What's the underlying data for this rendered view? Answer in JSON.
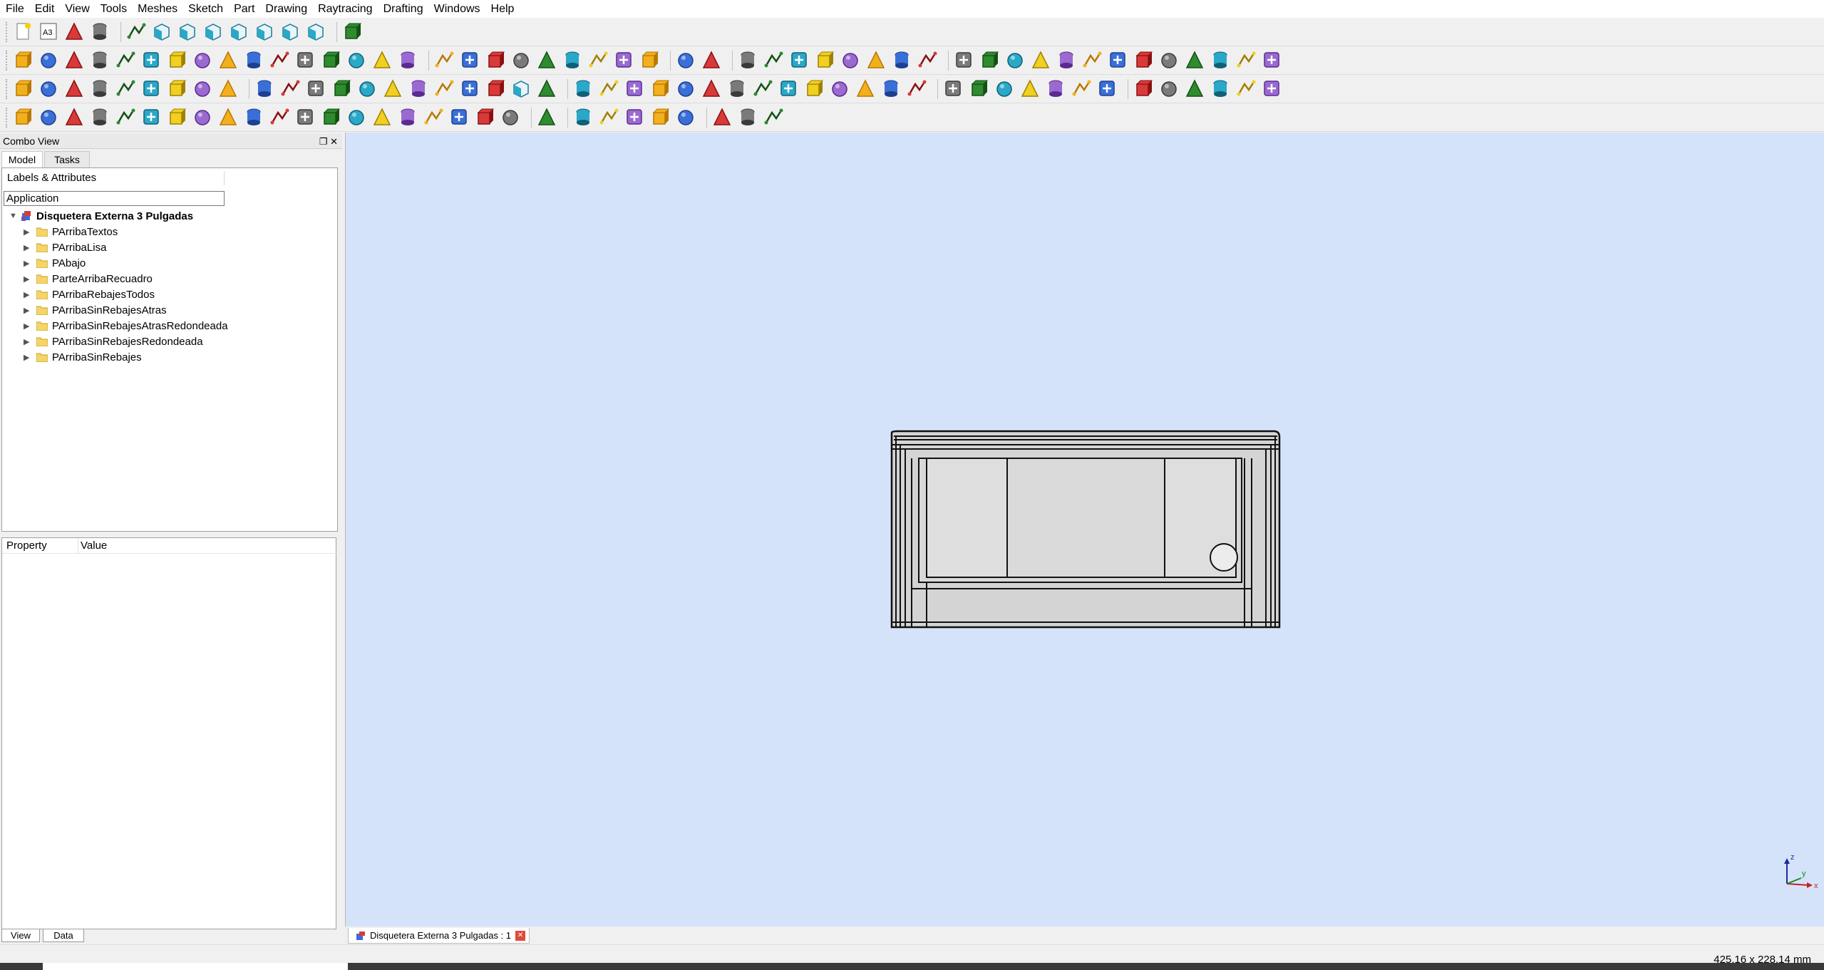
{
  "menu": [
    "File",
    "Edit",
    "View",
    "Tools",
    "Meshes",
    "Sketch",
    "Part",
    "Drawing",
    "Raytracing",
    "Drafting",
    "Windows",
    "Help"
  ],
  "toolbar": {
    "a3_label": "A3",
    "row1_icons": [
      "new-document-icon",
      "a3-page-icon",
      "open-template-icon",
      "save-icon",
      "zoom-fit-icon",
      "isometric-view-icon",
      "front-view-icon",
      "top-view-icon",
      "right-view-icon",
      "rear-view-icon",
      "bottom-view-icon",
      "left-view-icon",
      "measure-icon"
    ],
    "row2_icons": [
      "cube-icon",
      "cylinder-icon",
      "sphere-icon",
      "cone-icon",
      "torus-icon",
      "boolean-icon",
      "cut-icon",
      "fuse-icon",
      "common-icon",
      "section-icon",
      "extrude-icon",
      "revolve-icon",
      "mirror-icon",
      "fillet-icon",
      "chamfer-icon",
      "loft-icon",
      "sweep-icon",
      "offset-icon",
      "thickness-icon",
      "shape-builder-icon",
      "refine-icon",
      "compound-icon",
      "split-icon",
      "explode-icon",
      "check-geometry-icon",
      "new-drawing-icon",
      "export-page-icon",
      "point-icon",
      "polyline-icon",
      "circle-icon",
      "arc-icon",
      "bspline-icon",
      "rectangle-icon",
      "constraint-lock-icon",
      "trim-icon",
      "external-geometry-icon",
      "construction-icon",
      "box-primitive-icon",
      "primitives-icon",
      "cone-primitive-icon",
      "cylinder-primitive-icon",
      "tube-icon",
      "sphere-primitive-icon",
      "ellipsoid-icon",
      "wedge-icon",
      "prism-icon",
      "helix-icon",
      "plane-icon"
    ],
    "row3_icons": [
      "line-icon",
      "wire-icon",
      "draft-circle-icon",
      "draft-arc-icon",
      "draft-rectangle-icon",
      "polygon-icon",
      "draft-bspline-icon",
      "text-icon",
      "dimension-icon",
      "move-icon",
      "rotate-icon",
      "offset-draft-icon",
      "stretch-icon",
      "upgrade-icon",
      "downgrade-icon",
      "scale-icon",
      "edit-icon",
      "add-point-icon",
      "delete-point-icon",
      "shape2dview-icon",
      "point-constraint-icon",
      "fillet-constraint-icon",
      "vertical-constraint-icon",
      "horizontal-constraint-icon",
      "parallel-constraint-icon",
      "perpendicular-constraint-icon",
      "tangent-constraint-icon",
      "equal-constraint-icon",
      "symmetric-constraint-icon",
      "lock-constraint-icon",
      "horizontal-distance-icon",
      "vertical-distance-icon",
      "distance-icon",
      "radius-icon",
      "angle-icon",
      "raytrace-new-icon",
      "raytrace-part-icon",
      "raytrace-export-icon",
      "raytrace-render-icon",
      "raytrace-camera-icon",
      "raytrace-go-icon",
      "mesh-import-icon",
      "mesh-export-icon",
      "mesh-from-shape-icon",
      "mesh-analyze-icon",
      "mesh-harmonize-icon",
      "mesh-flip-icon",
      "mesh-segments-icon"
    ],
    "row4_icons": [
      "snap-lock-icon",
      "snap-endpoint-icon",
      "snap-midpoint-icon",
      "snap-center-icon",
      "snap-angle-icon",
      "snap-intersection-icon",
      "snap-perpendicular-icon",
      "snap-extension-icon",
      "snap-parallel-icon",
      "snap-special-icon",
      "snap-near-icon",
      "snap-ortho-icon",
      "snap-grid-icon",
      "snap-workingplane-icon",
      "snap-dimensions-icon",
      "toggle-grid-icon",
      "toggle-construction-icon",
      "toggle-continue-icon",
      "toggle-display-icon",
      "add-to-group-icon",
      "draft-select-icon",
      "wireframe-icon",
      "facet-icon",
      "clone-icon",
      "array-icon",
      "path-array-icon",
      "point-array-icon",
      "draft-shape-icon",
      "heal-icon"
    ]
  },
  "combo_view": {
    "title": "Combo View",
    "buttons": "❐ ✕",
    "tabs": [
      "Model",
      "Tasks"
    ],
    "labels_header": "Labels & Attributes",
    "application_field": "Application",
    "document_name": "Disquetera Externa 3 Pulgadas",
    "tree_items": [
      "PArribaTextos",
      "PArribaLisa",
      "PAbajo",
      "ParteArribaRecuadro",
      "PArribaRebajesTodos",
      "PArribaSinRebajesAtras",
      "PArribaSinRebajesAtrasRedondeada",
      "PArribaSinRebajesRedondeada",
      "PArribaSinRebajes"
    ],
    "property_col": "Property",
    "value_col": "Value",
    "bottom_tabs": [
      "View",
      "Data"
    ]
  },
  "viewport": {
    "background": "#d5e3fa",
    "axis_labels": [
      "z",
      "x",
      "y"
    ]
  },
  "document_tab": {
    "label": "Disquetera Externa 3 Pulgadas : 1",
    "close": "✕"
  },
  "status": {
    "dimensions": "425.16 x 228.14 mm"
  }
}
